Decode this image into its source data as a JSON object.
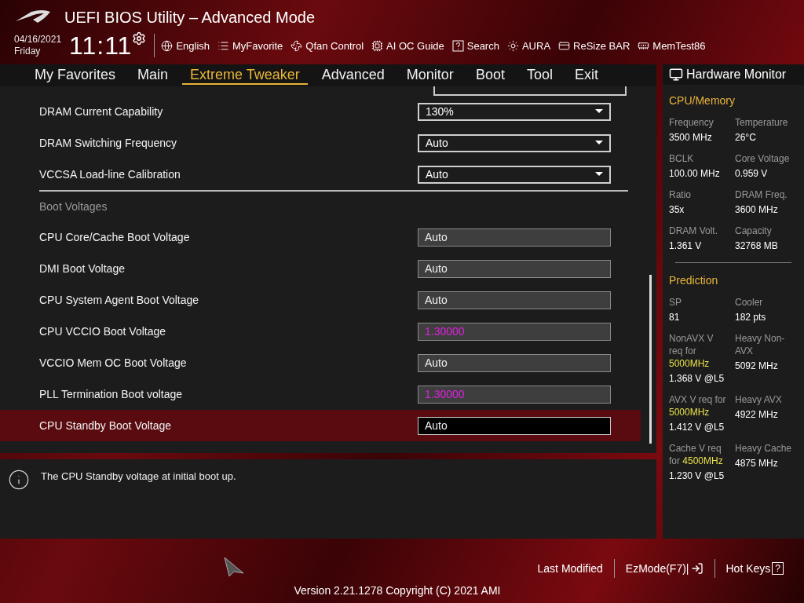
{
  "header": {
    "title": "UEFI BIOS Utility – Advanced Mode",
    "date": "04/16/2021",
    "day": "Friday",
    "time": "11:11",
    "tools": [
      {
        "kind": "globe",
        "label": "English"
      },
      {
        "kind": "list",
        "label": "MyFavorite"
      },
      {
        "kind": "fan",
        "label": "Qfan Control"
      },
      {
        "kind": "chip",
        "label": "AI OC Guide"
      },
      {
        "kind": "help",
        "label": "Search"
      },
      {
        "kind": "light",
        "label": "AURA"
      },
      {
        "kind": "card",
        "label": "ReSize BAR"
      },
      {
        "kind": "memory",
        "label": "MemTest86"
      }
    ]
  },
  "tabs": [
    {
      "label": "My Favorites",
      "selected": false
    },
    {
      "label": "Main",
      "selected": false
    },
    {
      "label": "Extreme Tweaker",
      "selected": true
    },
    {
      "label": "Advanced",
      "selected": false
    },
    {
      "label": "Monitor",
      "selected": false
    },
    {
      "label": "Boot",
      "selected": false
    },
    {
      "label": "Tool",
      "selected": false
    },
    {
      "label": "Exit",
      "selected": false
    }
  ],
  "settings": [
    {
      "kind": "dropdown",
      "label": "DRAM Current Capability",
      "value": "130%",
      "changed": false,
      "selected": false
    },
    {
      "kind": "dropdown",
      "label": "DRAM Switching Frequency",
      "value": "Auto",
      "changed": false,
      "selected": false
    },
    {
      "kind": "dropdown",
      "label": "VCCSA Load-line Calibration",
      "value": "Auto",
      "changed": false,
      "selected": false
    },
    {
      "kind": "section",
      "label": "Boot Voltages"
    },
    {
      "kind": "input",
      "label": "CPU Core/Cache Boot Voltage",
      "value": "Auto",
      "changed": false,
      "selected": false
    },
    {
      "kind": "input",
      "label": "DMI Boot Voltage",
      "value": "Auto",
      "changed": false,
      "selected": false
    },
    {
      "kind": "input",
      "label": "CPU System Agent Boot Voltage",
      "value": "Auto",
      "changed": false,
      "selected": false
    },
    {
      "kind": "input",
      "label": "CPU VCCIO Boot Voltage",
      "value": "1.30000",
      "changed": true,
      "selected": false
    },
    {
      "kind": "input",
      "label": "VCCIO Mem OC Boot Voltage",
      "value": "Auto",
      "changed": false,
      "selected": false
    },
    {
      "kind": "input",
      "label": "PLL Termination Boot voltage",
      "value": "1.30000",
      "changed": true,
      "selected": false
    },
    {
      "kind": "input",
      "label": "CPU Standby Boot Voltage",
      "value": "Auto",
      "changed": false,
      "selected": true
    }
  ],
  "help": "The CPU Standby voltage at initial boot up.",
  "hardware_monitor": {
    "title": "Hardware Monitor",
    "sections": [
      {
        "title": "CPU/Memory",
        "items": [
          {
            "label": "Frequency",
            "value": "3500 MHz"
          },
          {
            "label": "Temperature",
            "value": "26°C"
          },
          {
            "label": "BCLK",
            "value": "100.00 MHz"
          },
          {
            "label": "Core Voltage",
            "value": "0.959 V"
          },
          {
            "label": "Ratio",
            "value": "35x"
          },
          {
            "label": "DRAM Freq.",
            "value": "3600 MHz"
          },
          {
            "label": "DRAM Volt.",
            "value": "1.361 V"
          },
          {
            "label": "Capacity",
            "value": "32768 MB"
          }
        ]
      },
      {
        "title": "Prediction",
        "items": [
          {
            "label": "SP",
            "value": "81"
          },
          {
            "label": "Cooler",
            "value": "182 pts"
          },
          {
            "label": "NonAVX V req for **5000MHz**",
            "value": "1.368 V @L5"
          },
          {
            "label": "Heavy Non-AVX",
            "value": "5092 MHz"
          },
          {
            "label": "AVX V req for **5000MHz**",
            "value": "1.412 V @L5"
          },
          {
            "label": "Heavy AVX",
            "value": "4922 MHz"
          },
          {
            "label": "Cache V req for **4500MHz**",
            "value": "1.230 V @L5"
          },
          {
            "label": "Heavy Cache",
            "value": "4875 MHz"
          }
        ]
      }
    ]
  },
  "footer": {
    "links": [
      "Last Modified",
      "EzMode(F7)|",
      "Hot Keys"
    ],
    "hot_keys_key": "?",
    "version": "Version 2.21.1278 Copyright (C) 2021 AMI"
  }
}
